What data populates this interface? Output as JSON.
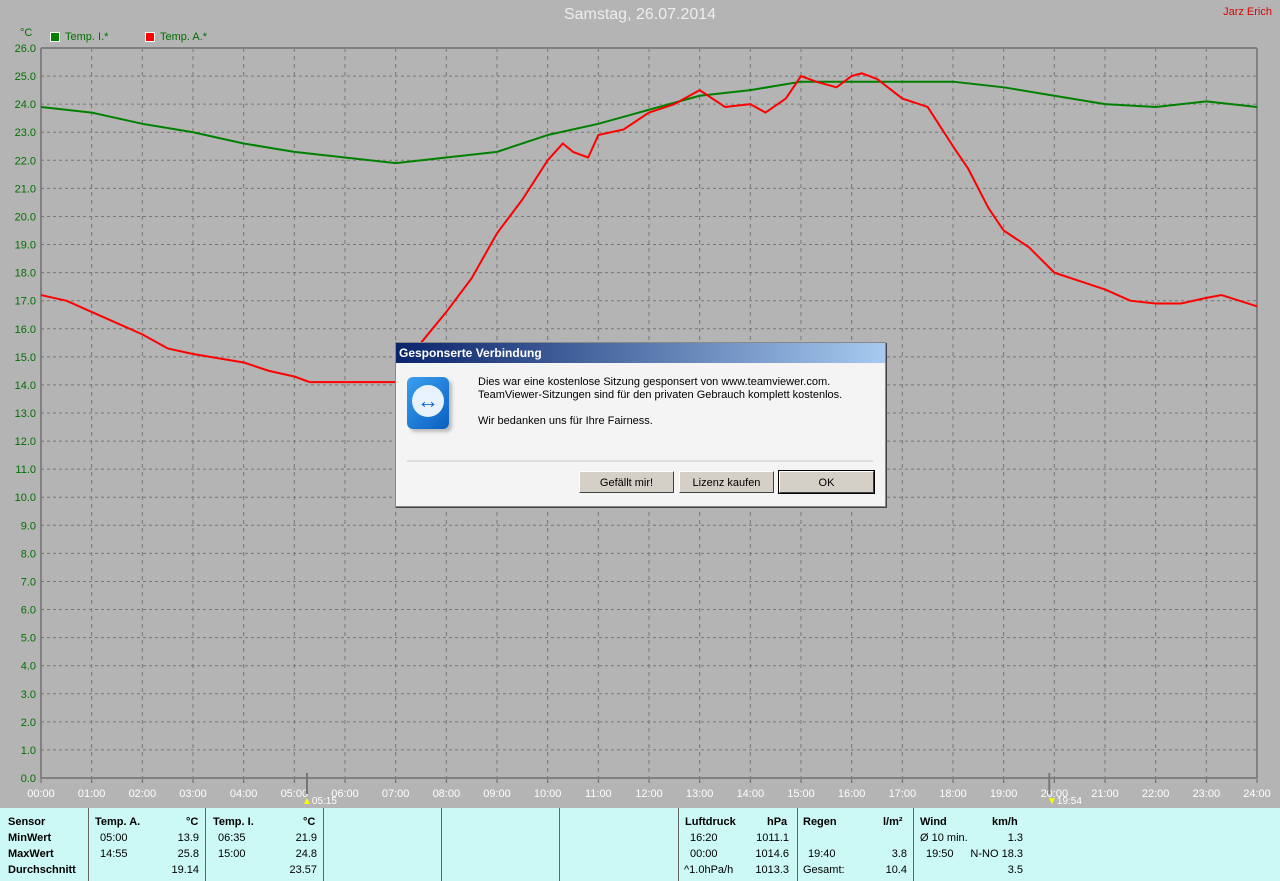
{
  "header": {
    "title": "Samstag, 26.07.2014",
    "owner": "Jarz Erich"
  },
  "chart_data": {
    "type": "line",
    "ylabel": "°C",
    "ylim": [
      0,
      26
    ],
    "xlim": [
      "00:00",
      "24:00"
    ],
    "grid": true,
    "legend": "top-left",
    "xticks": [
      "00:00",
      "01:00",
      "02:00",
      "03:00",
      "04:00",
      "05:00",
      "06:00",
      "07:00",
      "08:00",
      "09:00",
      "10:00",
      "11:00",
      "12:00",
      "13:00",
      "14:00",
      "15:00",
      "16:00",
      "17:00",
      "18:00",
      "19:00",
      "20:00",
      "21:00",
      "22:00",
      "23:00",
      "24:00"
    ],
    "yticks": [
      "0.0",
      "1.0",
      "2.0",
      "3.0",
      "4.0",
      "5.0",
      "6.0",
      "7.0",
      "8.0",
      "9.0",
      "10.0",
      "11.0",
      "12.0",
      "13.0",
      "14.0",
      "15.0",
      "16.0",
      "17.0",
      "18.0",
      "19.0",
      "20.0",
      "21.0",
      "22.0",
      "23.0",
      "24.0",
      "25.0",
      "26.0"
    ],
    "series": [
      {
        "name": "Temp. I.*",
        "color": "#008000",
        "x": [
          0,
          1,
          2,
          3,
          4,
          5,
          6,
          7,
          8,
          9,
          10,
          11,
          12,
          13,
          14,
          15,
          16,
          17,
          18,
          19,
          20,
          21,
          22,
          23,
          24
        ],
        "y": [
          23.9,
          23.7,
          23.3,
          23.0,
          22.6,
          22.3,
          22.1,
          21.9,
          22.1,
          22.3,
          22.9,
          23.3,
          23.8,
          24.3,
          24.5,
          24.8,
          24.8,
          24.8,
          24.8,
          24.6,
          24.3,
          24.0,
          23.9,
          24.1,
          23.9
        ]
      },
      {
        "name": "Temp. A.*",
        "color": "#ff0000",
        "x": [
          0,
          0.5,
          1,
          2,
          2.5,
          3,
          4,
          4.5,
          5,
          5.3,
          6,
          7,
          7.5,
          8,
          8.5,
          9,
          9.5,
          10,
          10.3,
          10.5,
          10.8,
          11,
          11.5,
          12,
          12.5,
          13,
          13.5,
          14,
          14.3,
          14.7,
          15,
          15.3,
          15.7,
          16,
          16.2,
          16.5,
          17,
          17.5,
          18,
          18.3,
          18.7,
          19,
          19.5,
          20,
          20.5,
          21,
          21.5,
          22,
          22.5,
          23,
          23.3,
          24
        ],
        "y": [
          17.2,
          17.0,
          16.6,
          15.8,
          15.3,
          15.1,
          14.8,
          14.5,
          14.3,
          14.1,
          14.1,
          14.1,
          15.5,
          16.6,
          17.8,
          19.4,
          20.6,
          22.0,
          22.6,
          22.3,
          22.1,
          22.9,
          23.1,
          23.7,
          24.0,
          24.5,
          23.9,
          24.0,
          23.7,
          24.2,
          25.0,
          24.8,
          24.6,
          25.0,
          25.1,
          24.9,
          24.2,
          23.9,
          22.5,
          21.7,
          20.3,
          19.5,
          18.9,
          18.0,
          17.7,
          17.4,
          17.0,
          16.9,
          16.9,
          17.1,
          17.2,
          16.8
        ]
      }
    ],
    "markers": [
      {
        "label": "05:15",
        "icon": "sunrise-icon"
      },
      {
        "label": "19:54",
        "icon": "sunset-icon"
      }
    ]
  },
  "table": {
    "sensor": {
      "header": "Sensor",
      "rows": [
        "MinWert",
        "MaxWert",
        "Durchschnitt"
      ]
    },
    "temp_a": {
      "header": "Temp. A.",
      "unit": "°C",
      "min_time": "05:00",
      "min": "13.9",
      "max_time": "14:55",
      "max": "25.8",
      "avg": "19.14"
    },
    "temp_i": {
      "header": "Temp. I.",
      "unit": "°C",
      "min_time": "06:35",
      "min": "21.9",
      "max_time": "15:00",
      "max": "24.8",
      "avg": "23.57"
    },
    "luftdruck": {
      "header": "Luftdruck",
      "unit": "hPa",
      "r1a": "16:20",
      "r1b": "1011.1",
      "r2a": "00:00",
      "r2b": "1014.6",
      "r3a": "^1.0hPa/h",
      "r3b": "1013.3"
    },
    "regen": {
      "header": "Regen",
      "unit": "l/m²",
      "r2a": "19:40",
      "r2b": "3.8",
      "r3a": "Gesamt:",
      "r3b": "10.4"
    },
    "wind": {
      "header": "Wind",
      "unit": "km/h",
      "r1a": "Ø 10 min.",
      "r1b": "1.3",
      "r2a": "19:50",
      "r2b": "N-NO 18.3",
      "r3b": "3.5"
    }
  },
  "dialog": {
    "title": "Gesponserte Verbindung",
    "line1": "Dies war eine kostenlose Sitzung gesponsert von www.teamviewer.com.",
    "line2": "TeamViewer-Sitzungen sind für den privaten Gebrauch komplett kostenlos.",
    "line3": "Wir bedanken uns für Ihre Fairness.",
    "btn_like": "Gefällt mir!",
    "btn_license": "Lizenz kaufen",
    "btn_ok": "OK"
  }
}
